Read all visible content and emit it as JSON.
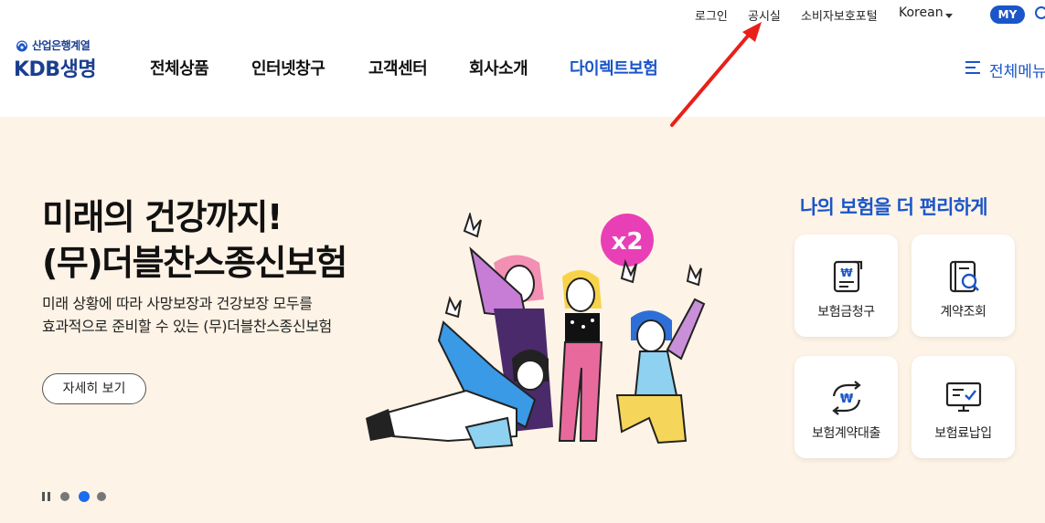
{
  "header": {
    "util": {
      "login": "로그인",
      "notice": "공시실",
      "portal": "소비자보호포털",
      "language": "Korean",
      "my": "MY"
    },
    "logo": {
      "sub": "산업은행계열",
      "main": "KDB생명"
    },
    "gnb": [
      "전체상품",
      "인터넷창구",
      "고객센터",
      "회사소개",
      "다이렉트보험"
    ],
    "all_menu": "전체메뉴"
  },
  "hero": {
    "title_line1": "미래의 건강까지!",
    "title_line2": "(무)더블찬스종신보험",
    "desc_line1": "미래 상황에 따라 사망보장과 건강보장 모두를",
    "desc_line2": "효과적으로 준비할 수 있는 (무)더블찬스종신보험",
    "detail_button": "자세히 보기",
    "badge": "x2",
    "slides": {
      "total": 3,
      "current": 2
    }
  },
  "quick": {
    "title": "나의 보험을 더 편리하게",
    "items": [
      {
        "label": "보험금청구",
        "icon": "claim-document-icon"
      },
      {
        "label": "계약조회",
        "icon": "contract-search-icon"
      },
      {
        "label": "보험계약대출",
        "icon": "loan-exchange-icon"
      },
      {
        "label": "보험료납입",
        "icon": "premium-payment-monitor-icon"
      }
    ]
  },
  "colors": {
    "brand_blue": "#1a55c9",
    "hero_bg": "#fdf3e6",
    "annotation_arrow": "#e8201a"
  }
}
